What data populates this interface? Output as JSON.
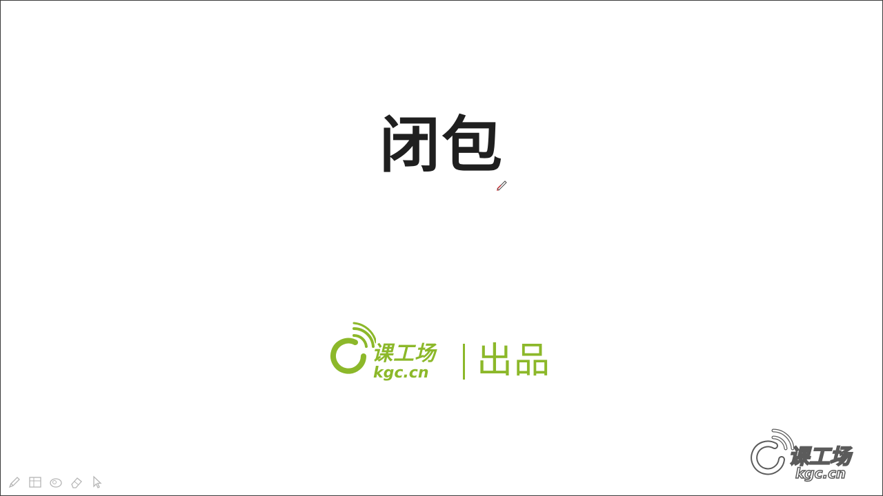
{
  "slide": {
    "title": "闭包",
    "brand": {
      "name": "课工场",
      "domain": "kgc.cn",
      "product": "出品",
      "color": "#8cb82a"
    }
  },
  "watermark": {
    "name": "课工场",
    "domain": "kgc.cn"
  },
  "toolbar": {
    "items": [
      {
        "icon": "pen-icon"
      },
      {
        "icon": "slides-grid-icon"
      },
      {
        "icon": "zoom-icon"
      },
      {
        "icon": "eraser-icon"
      },
      {
        "icon": "pointer-icon"
      }
    ]
  },
  "cursor": {
    "icon": "pen-cursor-icon"
  }
}
